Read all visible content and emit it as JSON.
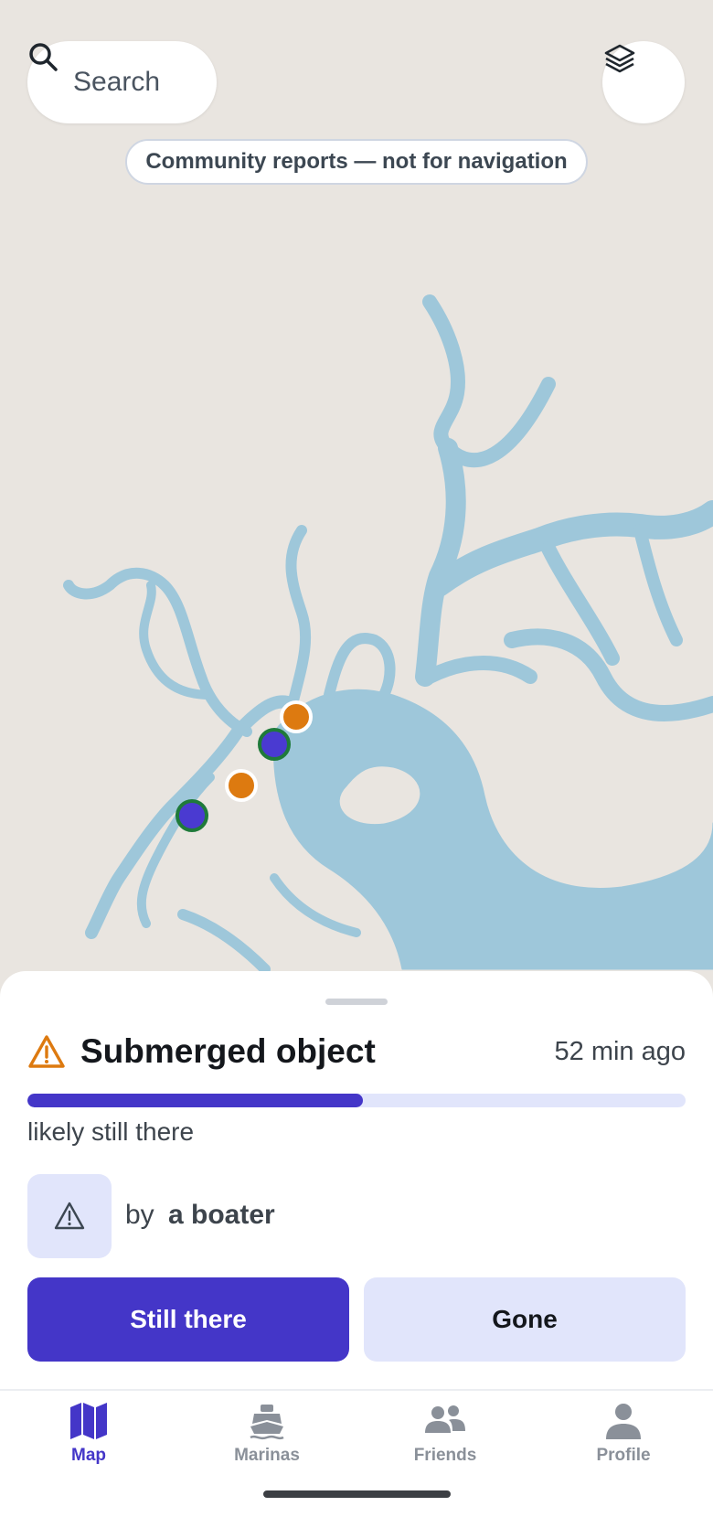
{
  "search": {
    "label": "Search"
  },
  "disclaimer": "Community reports — not for navigation",
  "map": {
    "land_color": "#e9e5e0",
    "water_color": "#9ec7da",
    "markers": [
      {
        "type": "report",
        "color": "#dd7a10"
      },
      {
        "type": "report",
        "color": "#dd7a10"
      },
      {
        "type": "marina",
        "color": "#4a3ad1"
      },
      {
        "type": "marina",
        "color": "#4a3ad1"
      }
    ]
  },
  "report": {
    "icon": "warning-icon",
    "title": "Submerged object",
    "time_ago": "52 min ago",
    "likelihood_fraction": 0.51,
    "status": "likely still there",
    "by_prefix": "by",
    "author": "a boater",
    "still_there_label": "Still there",
    "gone_label": "Gone"
  },
  "nav": {
    "items": [
      {
        "label": "Map",
        "icon": "map-icon",
        "active": true
      },
      {
        "label": "Marinas",
        "icon": "boat-icon",
        "active": false
      },
      {
        "label": "Friends",
        "icon": "people-icon",
        "active": false
      },
      {
        "label": "Profile",
        "icon": "person-icon",
        "active": false
      }
    ]
  },
  "colors": {
    "accent": "#4436c8",
    "accent_light": "#e1e5fb",
    "warning": "#dd7a10"
  }
}
